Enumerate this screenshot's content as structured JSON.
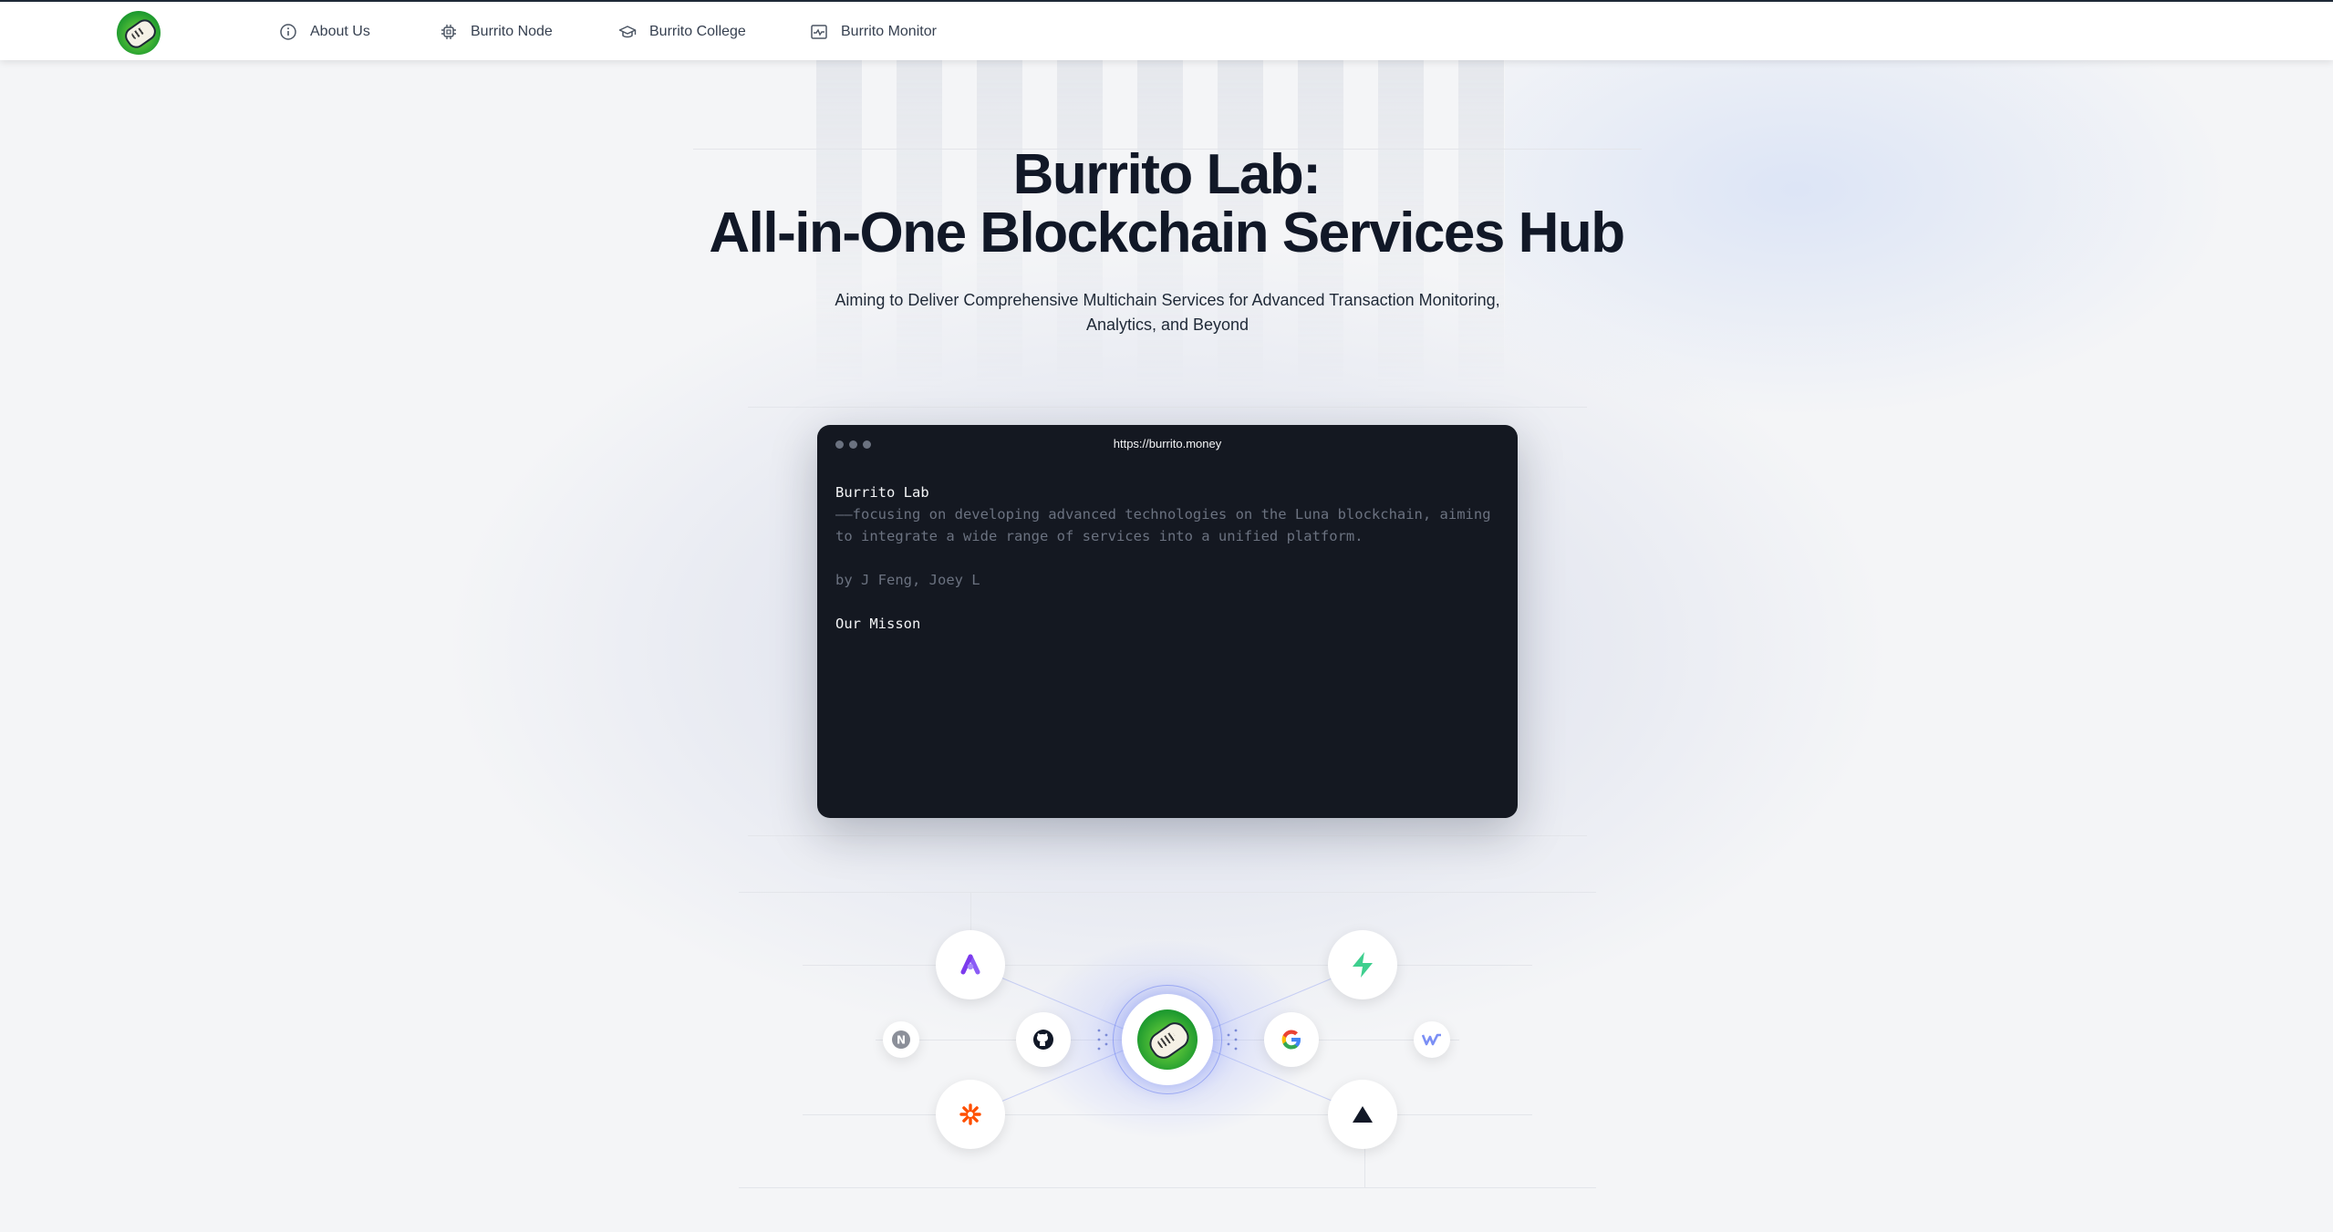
{
  "header": {
    "logo_name": "burrito-logo",
    "nav": [
      {
        "label": "About Us",
        "icon": "info-icon"
      },
      {
        "label": "Burrito Node",
        "icon": "chip-icon"
      },
      {
        "label": "Burrito College",
        "icon": "graduation-cap-icon"
      },
      {
        "label": "Burrito Monitor",
        "icon": "monitor-chart-icon"
      }
    ]
  },
  "hero": {
    "title_line1": "Burrito Lab:",
    "title_line2": "All-in-One Blockchain Services Hub",
    "subtitle_line1": "Aiming to Deliver Comprehensive Multichain Services for Advanced Transaction Monitoring,",
    "subtitle_line2": "Analytics, and Beyond"
  },
  "terminal": {
    "url": "https://burrito.money",
    "heading": "Burrito Lab",
    "desc_line1": "——focusing on developing advanced technologies on the Luna blockchain, aiming",
    "desc_line2": "to integrate a wide range of services into a unified platform.",
    "authors": "by J Feng, Joey L",
    "mission": "Our Misson"
  },
  "integrations": {
    "center": "burrito-logo",
    "nodes": [
      "notion-icon",
      "github-icon",
      "google-icon",
      "webflow-icon",
      "arc-icon",
      "zapier-icon",
      "supabase-icon",
      "vercel-icon"
    ]
  },
  "colors": {
    "terminal_bg": "#141821",
    "accent_glow": "#6e82f0",
    "background": "#f4f5f7"
  }
}
